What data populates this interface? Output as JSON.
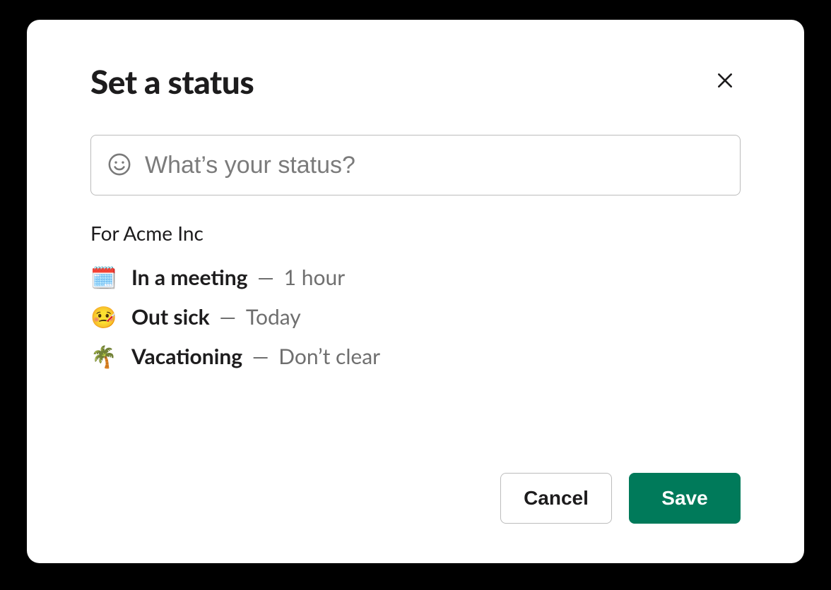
{
  "modal": {
    "title": "Set a status",
    "close_icon": "close-icon"
  },
  "status_input": {
    "placeholder": "What’s your status?",
    "value": ""
  },
  "presets": {
    "heading": "For Acme Inc",
    "separator": " — ",
    "items": [
      {
        "emoji": "🗓️",
        "label": "In a meeting",
        "duration": "1 hour"
      },
      {
        "emoji": "🤒",
        "label": "Out sick",
        "duration": "Today"
      },
      {
        "emoji": "🌴",
        "label": "Vacationing",
        "duration": "Don’t clear"
      }
    ]
  },
  "footer": {
    "cancel_label": "Cancel",
    "save_label": "Save"
  },
  "colors": {
    "primary": "#007a5a",
    "text": "#1d1c1d",
    "muted": "#6f6f6f",
    "border": "#bcbcbc"
  }
}
